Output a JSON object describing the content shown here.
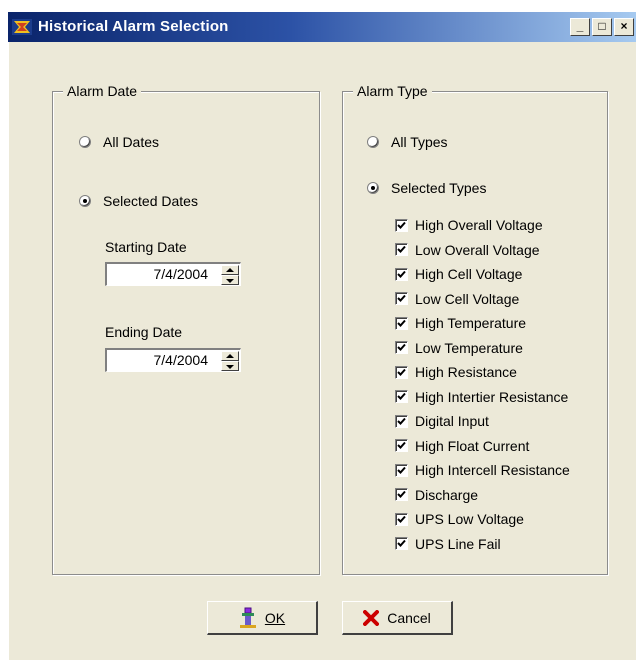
{
  "window": {
    "title": "Historical Alarm Selection",
    "minimize_label": "_",
    "maximize_label": "□",
    "close_label": "×"
  },
  "alarm_date": {
    "group_label": "Alarm Date",
    "all_dates_label": "All Dates",
    "selected_dates_label": "Selected Dates",
    "selected_option": "Selected Dates",
    "starting_date_label": "Starting Date",
    "starting_date_value": "7/4/2004",
    "ending_date_label": "Ending Date",
    "ending_date_value": "7/4/2004"
  },
  "alarm_type": {
    "group_label": "Alarm Type",
    "all_types_label": "All Types",
    "selected_types_label": "Selected Types",
    "selected_option": "Selected Types",
    "types": [
      {
        "label": "High Overall Voltage",
        "checked": true
      },
      {
        "label": "Low Overall Voltage",
        "checked": true
      },
      {
        "label": "High Cell Voltage",
        "checked": true
      },
      {
        "label": "Low Cell Voltage",
        "checked": true
      },
      {
        "label": "High Temperature",
        "checked": true
      },
      {
        "label": "Low Temperature",
        "checked": true
      },
      {
        "label": "High Resistance",
        "checked": true
      },
      {
        "label": "High Intertier Resistance",
        "checked": true
      },
      {
        "label": "Digital Input",
        "checked": true
      },
      {
        "label": "High Float Current",
        "checked": true
      },
      {
        "label": "High Intercell Resistance",
        "checked": true
      },
      {
        "label": "Discharge",
        "checked": true
      },
      {
        "label": "UPS Low Voltage",
        "checked": true
      },
      {
        "label": "UPS Line Fail",
        "checked": true
      }
    ]
  },
  "buttons": {
    "ok_label": "OK",
    "cancel_label": "Cancel"
  },
  "colors": {
    "titlebar_start": "#0a246a",
    "titlebar_end": "#a6caf0",
    "dialog_background": "#ece9d8",
    "cancel_icon": "#cc0000"
  }
}
